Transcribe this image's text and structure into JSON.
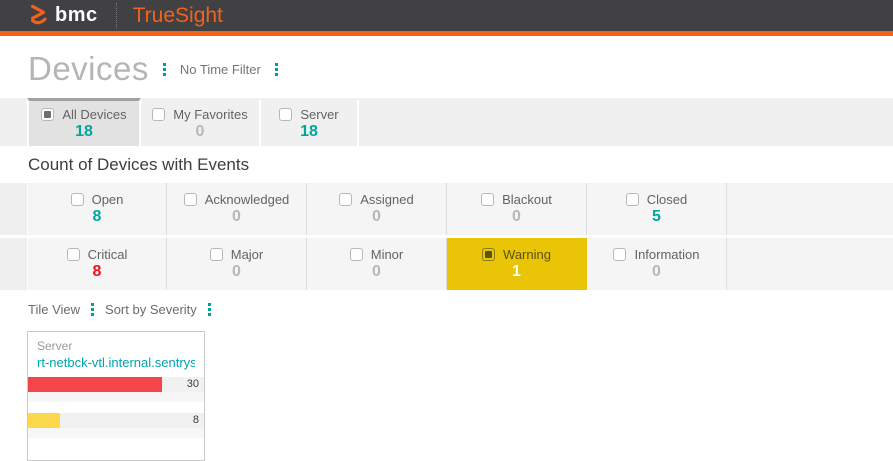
{
  "colors": {
    "orange": "#f4611c",
    "topbar": "#414143",
    "teal": "#00a69c",
    "dots": "#009e99",
    "red": "#f20d19",
    "warning": "#e9c407",
    "barred": "#f4454b",
    "baryellow": "#fbd84c",
    "link": "#00a3ad"
  },
  "topbar": {
    "logo_text": "bmc",
    "product": "TrueSight"
  },
  "page": {
    "title": "Devices",
    "time_filter": "No Time Filter"
  },
  "tabs": [
    {
      "label": "All Devices",
      "count": "18",
      "tone": "teal",
      "checked": "true",
      "selected": "true"
    },
    {
      "label": "My Favorites",
      "count": "0",
      "tone": "gray",
      "checked": "false",
      "selected": "false"
    },
    {
      "label": "Server",
      "count": "18",
      "tone": "teal",
      "checked": "false",
      "selected": "false"
    }
  ],
  "section": {
    "title": "Count of Devices with Events"
  },
  "status_row": [
    {
      "label": "Open",
      "count": "8",
      "tone": "teal",
      "checked": "false"
    },
    {
      "label": "Acknowledged",
      "count": "0",
      "tone": "gray",
      "checked": "false"
    },
    {
      "label": "Assigned",
      "count": "0",
      "tone": "gray",
      "checked": "false"
    },
    {
      "label": "Blackout",
      "count": "0",
      "tone": "gray",
      "checked": "false"
    },
    {
      "label": "Closed",
      "count": "5",
      "tone": "teal",
      "checked": "false"
    }
  ],
  "severity_row": [
    {
      "label": "Critical",
      "count": "8",
      "tone": "red",
      "checked": "false",
      "selected": "false"
    },
    {
      "label": "Major",
      "count": "0",
      "tone": "gray",
      "checked": "false",
      "selected": "false"
    },
    {
      "label": "Minor",
      "count": "0",
      "tone": "gray",
      "checked": "false",
      "selected": "false"
    },
    {
      "label": "Warning",
      "count": "1",
      "tone": "white",
      "checked": "true",
      "selected": "true"
    },
    {
      "label": "Information",
      "count": "0",
      "tone": "gray",
      "checked": "false",
      "selected": "false"
    }
  ],
  "toolbar": {
    "view_label": "Tile View",
    "sort_label": "Sort by Severity"
  },
  "device_tile": {
    "type_label": "Server",
    "name": "rt-netbck-vtl.internal.sentrys...",
    "chart_data": {
      "type": "bar",
      "orientation": "horizontal",
      "bars": [
        {
          "severity": "critical",
          "value": 30,
          "percent": 76,
          "color": "#f4454b"
        },
        {
          "severity": "warning",
          "value": 8,
          "percent": 18,
          "color": "#fbd84c"
        }
      ]
    }
  }
}
